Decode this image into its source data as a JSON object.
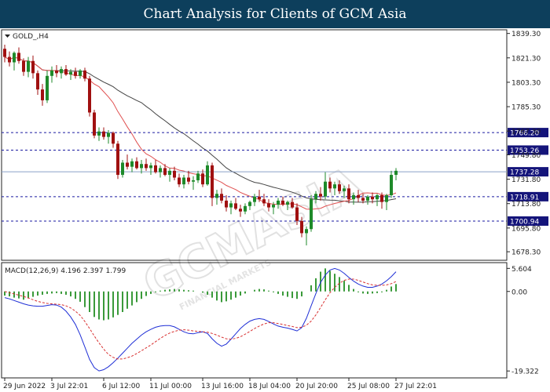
{
  "header": {
    "title": "Chart Analysis for Clients of GCM Asia"
  },
  "watermark": {
    "text": "GCMASIA",
    "tagline": "FINANCIAL MARKETS"
  },
  "colors": {
    "header_bg": "#0d3f5c",
    "bull": "#1e8a2a",
    "bear": "#a01010",
    "ma_fast": "#e05050",
    "ma_slow": "#444444",
    "level_line": "#1a1aa0",
    "current_price": "#8aa0c8",
    "label_bg": "#14147a",
    "macd_hist": "#3a9a3a",
    "macd_main": "#1f2fd6",
    "macd_signal": "#d83030"
  },
  "chart_data": {
    "type": "candlestick",
    "symbol": "GOLD_,H4",
    "price_axis": {
      "range": [
        1672,
        1842
      ],
      "ticks": [
        "1839.30",
        "1821.30",
        "1803.30",
        "1785.30",
        "1767.30",
        "1749.80",
        "1731.80",
        "1713.80",
        "1695.80",
        "1678.30"
      ]
    },
    "time_axis": {
      "labels": [
        "29 Jun 2022",
        "3 Jul 22:01",
        "6 Jul 12:00",
        "11 Jul 00:00",
        "13 Jul 16:00",
        "18 Jul 04:00",
        "20 Jul 20:00",
        "25 Jul 08:00",
        "27 Jul 22:01"
      ]
    },
    "levels": [
      "1766.20",
      "1753.26",
      "1718.91",
      "1700.94"
    ],
    "current_price": "1737.28",
    "candles": [
      [
        1828,
        1831,
        1818,
        1822
      ],
      [
        1822,
        1826,
        1815,
        1818
      ],
      [
        1818,
        1826,
        1812,
        1825
      ],
      [
        1825,
        1829,
        1817,
        1819
      ],
      [
        1819,
        1821,
        1808,
        1811
      ],
      [
        1811,
        1822,
        1807,
        1819
      ],
      [
        1819,
        1823,
        1806,
        1810
      ],
      [
        1810,
        1812,
        1794,
        1798
      ],
      [
        1798,
        1802,
        1786,
        1790
      ],
      [
        1790,
        1812,
        1788,
        1808
      ],
      [
        1808,
        1815,
        1803,
        1812
      ],
      [
        1812,
        1816,
        1807,
        1810
      ],
      [
        1810,
        1815,
        1806,
        1813
      ],
      [
        1813,
        1816,
        1808,
        1809
      ],
      [
        1809,
        1813,
        1805,
        1811
      ],
      [
        1811,
        1814,
        1806,
        1808
      ],
      [
        1808,
        1813,
        1806,
        1812
      ],
      [
        1812,
        1814,
        1804,
        1806
      ],
      [
        1806,
        1808,
        1778,
        1781
      ],
      [
        1781,
        1783,
        1762,
        1764
      ],
      [
        1764,
        1770,
        1760,
        1767
      ],
      [
        1767,
        1770,
        1761,
        1763
      ],
      [
        1763,
        1768,
        1758,
        1766
      ],
      [
        1766,
        1767,
        1755,
        1758
      ],
      [
        1758,
        1760,
        1732,
        1735
      ],
      [
        1735,
        1746,
        1733,
        1744
      ],
      [
        1744,
        1750,
        1739,
        1741
      ],
      [
        1741,
        1747,
        1737,
        1745
      ],
      [
        1745,
        1748,
        1739,
        1740
      ],
      [
        1740,
        1746,
        1736,
        1743
      ],
      [
        1743,
        1747,
        1738,
        1740
      ],
      [
        1740,
        1744,
        1735,
        1742
      ],
      [
        1742,
        1746,
        1736,
        1737
      ],
      [
        1737,
        1742,
        1733,
        1740
      ],
      [
        1740,
        1743,
        1734,
        1735
      ],
      [
        1735,
        1740,
        1730,
        1738
      ],
      [
        1738,
        1741,
        1731,
        1733
      ],
      [
        1733,
        1736,
        1726,
        1728
      ],
      [
        1728,
        1735,
        1725,
        1733
      ],
      [
        1733,
        1738,
        1728,
        1730
      ],
      [
        1730,
        1734,
        1724,
        1731
      ],
      [
        1731,
        1738,
        1729,
        1736
      ],
      [
        1736,
        1739,
        1726,
        1728
      ],
      [
        1728,
        1745,
        1727,
        1742
      ],
      [
        1742,
        1744,
        1712,
        1718
      ],
      [
        1718,
        1724,
        1713,
        1721
      ],
      [
        1721,
        1725,
        1714,
        1716
      ],
      [
        1716,
        1720,
        1708,
        1711
      ],
      [
        1711,
        1716,
        1706,
        1714
      ],
      [
        1714,
        1718,
        1709,
        1710
      ],
      [
        1710,
        1713,
        1704,
        1708
      ],
      [
        1708,
        1714,
        1706,
        1712
      ],
      [
        1712,
        1716,
        1709,
        1715
      ],
      [
        1715,
        1721,
        1712,
        1719
      ],
      [
        1719,
        1724,
        1715,
        1717
      ],
      [
        1717,
        1721,
        1712,
        1714
      ],
      [
        1714,
        1717,
        1708,
        1711
      ],
      [
        1711,
        1715,
        1706,
        1713
      ],
      [
        1713,
        1718,
        1710,
        1716
      ],
      [
        1716,
        1719,
        1712,
        1713
      ],
      [
        1713,
        1716,
        1709,
        1715
      ],
      [
        1715,
        1718,
        1710,
        1711
      ],
      [
        1711,
        1714,
        1698,
        1701
      ],
      [
        1701,
        1704,
        1689,
        1692
      ],
      [
        1692,
        1697,
        1683,
        1695
      ],
      [
        1695,
        1720,
        1693,
        1717
      ],
      [
        1717,
        1723,
        1714,
        1721
      ],
      [
        1721,
        1726,
        1716,
        1719
      ],
      [
        1719,
        1737,
        1717,
        1730
      ],
      [
        1730,
        1733,
        1722,
        1725
      ],
      [
        1725,
        1730,
        1720,
        1728
      ],
      [
        1728,
        1731,
        1721,
        1723
      ],
      [
        1723,
        1727,
        1718,
        1725
      ],
      [
        1725,
        1728,
        1714,
        1717
      ],
      [
        1717,
        1722,
        1713,
        1720
      ],
      [
        1720,
        1724,
        1715,
        1718
      ],
      [
        1718,
        1721,
        1714,
        1716
      ],
      [
        1716,
        1720,
        1713,
        1719
      ],
      [
        1719,
        1722,
        1714,
        1717
      ],
      [
        1717,
        1721,
        1712,
        1720
      ],
      [
        1720,
        1722,
        1710,
        1715
      ],
      [
        1715,
        1721,
        1709,
        1720
      ],
      [
        1720,
        1738,
        1718,
        1735
      ],
      [
        1735,
        1740,
        1731,
        1738
      ]
    ],
    "indicator": {
      "label": "MACD(12,26,9) 4.196 2.397 1.799",
      "axis": {
        "range": [
          -21,
          7
        ],
        "ticks": [
          "5.604",
          "0.00",
          "-19.322"
        ]
      },
      "histogram": [
        -1.0,
        -1.2,
        -1.5,
        -1.7,
        -2.0,
        -1.6,
        -1.3,
        -1.0,
        -0.8,
        -0.6,
        -0.5,
        -0.4,
        -0.6,
        -0.8,
        -1.2,
        -1.8,
        -2.5,
        -3.8,
        -5.0,
        -6.2,
        -6.8,
        -7.0,
        -6.8,
        -6.3,
        -5.7,
        -5.0,
        -4.2,
        -3.4,
        -2.6,
        -1.8,
        -1.1,
        -0.6,
        -0.2,
        0.2,
        0.4,
        0.5,
        0.6,
        0.5,
        0.4,
        0.3,
        0.2,
        0.0,
        -0.3,
        -0.8,
        -1.5,
        -2.2,
        -2.6,
        -2.4,
        -2.0,
        -1.5,
        -1.0,
        -0.5,
        0.0,
        0.4,
        0.6,
        0.5,
        0.2,
        -0.2,
        -0.6,
        -1.0,
        -1.3,
        -1.6,
        -1.8,
        -1.2,
        0.0,
        1.5,
        3.2,
        4.8,
        5.6,
        5.0,
        4.3,
        3.5,
        2.6,
        1.6,
        0.6,
        -0.2,
        -0.5,
        -0.6,
        -0.5,
        -0.4,
        -0.2,
        0.4,
        1.2,
        1.8
      ],
      "main": [
        -1.5,
        -1.8,
        -2.2,
        -2.6,
        -3.0,
        -3.3,
        -3.5,
        -3.6,
        -3.6,
        -3.4,
        -3.2,
        -3.3,
        -3.8,
        -4.8,
        -6.2,
        -8.0,
        -10.5,
        -13.5,
        -16.5,
        -18.5,
        -19.3,
        -19.0,
        -18.3,
        -17.3,
        -16.2,
        -15.0,
        -13.8,
        -12.6,
        -11.6,
        -10.6,
        -9.8,
        -9.2,
        -8.7,
        -8.4,
        -8.3,
        -8.3,
        -8.6,
        -9.2,
        -9.8,
        -10.2,
        -10.3,
        -10.0,
        -9.8,
        -10.2,
        -11.5,
        -12.6,
        -13.3,
        -12.8,
        -11.6,
        -10.3,
        -9.0,
        -8.0,
        -7.2,
        -6.8,
        -6.6,
        -6.8,
        -7.3,
        -7.9,
        -8.4,
        -8.7,
        -8.9,
        -9.2,
        -9.6,
        -8.8,
        -6.5,
        -3.5,
        -0.5,
        2.2,
        4.0,
        5.2,
        5.6,
        5.2,
        4.4,
        3.4,
        2.5,
        1.8,
        1.3,
        1.0,
        1.0,
        1.3,
        1.8,
        2.6,
        3.6,
        4.8
      ],
      "signal": [
        0.0,
        -0.3,
        -0.6,
        -0.9,
        -1.2,
        -1.6,
        -2.0,
        -2.4,
        -2.7,
        -2.9,
        -3.0,
        -3.1,
        -3.2,
        -3.5,
        -4.0,
        -4.8,
        -5.8,
        -7.3,
        -9.0,
        -10.8,
        -12.5,
        -14.0,
        -15.3,
        -16.0,
        -16.4,
        -16.4,
        -16.1,
        -15.7,
        -15.1,
        -14.4,
        -13.7,
        -13.0,
        -12.2,
        -11.4,
        -10.7,
        -10.1,
        -9.7,
        -9.4,
        -9.3,
        -9.4,
        -9.6,
        -9.7,
        -9.8,
        -9.9,
        -10.2,
        -10.6,
        -11.1,
        -11.5,
        -11.6,
        -11.4,
        -11.0,
        -10.4,
        -9.7,
        -9.0,
        -8.4,
        -7.9,
        -7.6,
        -7.6,
        -7.8,
        -8.0,
        -8.3,
        -8.5,
        -8.8,
        -8.7,
        -8.2,
        -7.2,
        -5.7,
        -3.9,
        -2.0,
        -0.3,
        1.0,
        2.0,
        2.7,
        3.0,
        3.0,
        2.7,
        2.3,
        1.9,
        1.6,
        1.5,
        1.5,
        1.6,
        1.9,
        2.4
      ]
    }
  }
}
